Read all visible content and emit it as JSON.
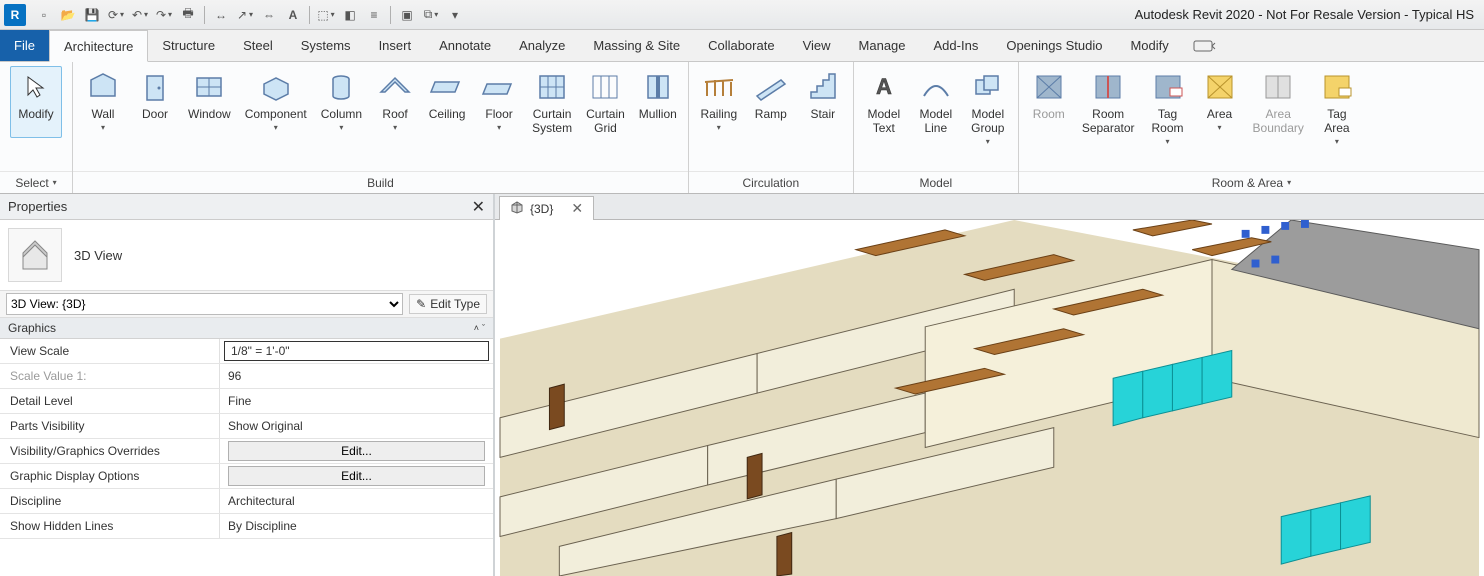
{
  "app_title": "Autodesk Revit 2020 - Not For Resale Version - Typical HS",
  "qat_icons": [
    "page-icon",
    "open-icon",
    "save-icon",
    "sync-icon",
    "undo-icon",
    "redo-icon",
    "print-icon",
    "measure-icon",
    "dim-icon",
    "dim2-icon",
    "text-icon",
    "3d-icon",
    "section-icon",
    "sheet-icon",
    "switch-icon",
    "close-icon",
    "more-icon"
  ],
  "tabs": [
    "File",
    "Architecture",
    "Structure",
    "Steel",
    "Systems",
    "Insert",
    "Annotate",
    "Analyze",
    "Massing & Site",
    "Collaborate",
    "View",
    "Manage",
    "Add-Ins",
    "Openings Studio",
    "Modify"
  ],
  "active_tab": "Architecture",
  "ribbon": {
    "select_panel": {
      "modify": "Modify",
      "label": "Select"
    },
    "build": {
      "items": [
        "Wall",
        "Door",
        "Window",
        "Component",
        "Column",
        "Roof",
        "Ceiling",
        "Floor",
        "Curtain\nSystem",
        "Curtain\nGrid",
        "Mullion"
      ],
      "label": "Build"
    },
    "circulation": {
      "items": [
        "Railing",
        "Ramp",
        "Stair"
      ],
      "label": "Circulation"
    },
    "model": {
      "items": [
        "Model\nText",
        "Model\nLine",
        "Model\nGroup"
      ],
      "label": "Model"
    },
    "room": {
      "items": [
        "Room",
        "Room\nSeparator",
        "Tag\nRoom",
        "Area",
        "Area\nBoundary",
        "Tag\nArea"
      ],
      "label": "Room & Area"
    }
  },
  "properties": {
    "title": "Properties",
    "type_label": "3D View",
    "instance": "3D View: {3D}",
    "edit_type": "Edit Type",
    "group": "Graphics",
    "rows": [
      {
        "name": "View Scale",
        "value": "1/8\" = 1'-0\"",
        "boxed": true
      },
      {
        "name": "Scale Value    1:",
        "value": "96",
        "dim": true
      },
      {
        "name": "Detail Level",
        "value": "Fine"
      },
      {
        "name": "Parts Visibility",
        "value": "Show Original"
      },
      {
        "name": "Visibility/Graphics Overrides",
        "value": "Edit...",
        "button": true
      },
      {
        "name": "Graphic Display Options",
        "value": "Edit...",
        "button": true
      },
      {
        "name": "Discipline",
        "value": "Architectural"
      },
      {
        "name": "Show Hidden Lines",
        "value": "By Discipline"
      }
    ]
  },
  "view_tab": "{3D}"
}
